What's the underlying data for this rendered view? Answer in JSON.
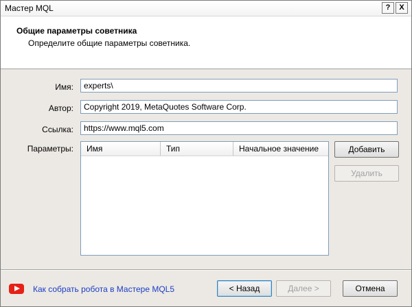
{
  "window": {
    "title": "Мастер MQL",
    "help_label": "?",
    "close_label": "X"
  },
  "header": {
    "title": "Общие параметры советника",
    "subtitle": "Определите общие параметры советника."
  },
  "form": {
    "name": {
      "label": "Имя:",
      "value": "experts\\"
    },
    "author": {
      "label": "Автор:",
      "value": "Copyright 2019, MetaQuotes Software Corp."
    },
    "link": {
      "label": "Ссылка:",
      "value": "https://www.mql5.com"
    },
    "params_label": "Параметры:"
  },
  "params_table": {
    "columns": [
      "Имя",
      "Тип",
      "Начальное значение"
    ],
    "rows": []
  },
  "side_buttons": {
    "add": "Добавить",
    "remove": "Удалить"
  },
  "footer": {
    "help_link": "Как собрать робота в Мастере MQL5",
    "help_icon": "youtube-play-icon",
    "back": "< Назад",
    "next": "Далее >",
    "cancel": "Отмена"
  },
  "colors": {
    "link": "#1a3dc6",
    "youtube": "#e62117",
    "disabled_text": "#a0a0a0"
  }
}
